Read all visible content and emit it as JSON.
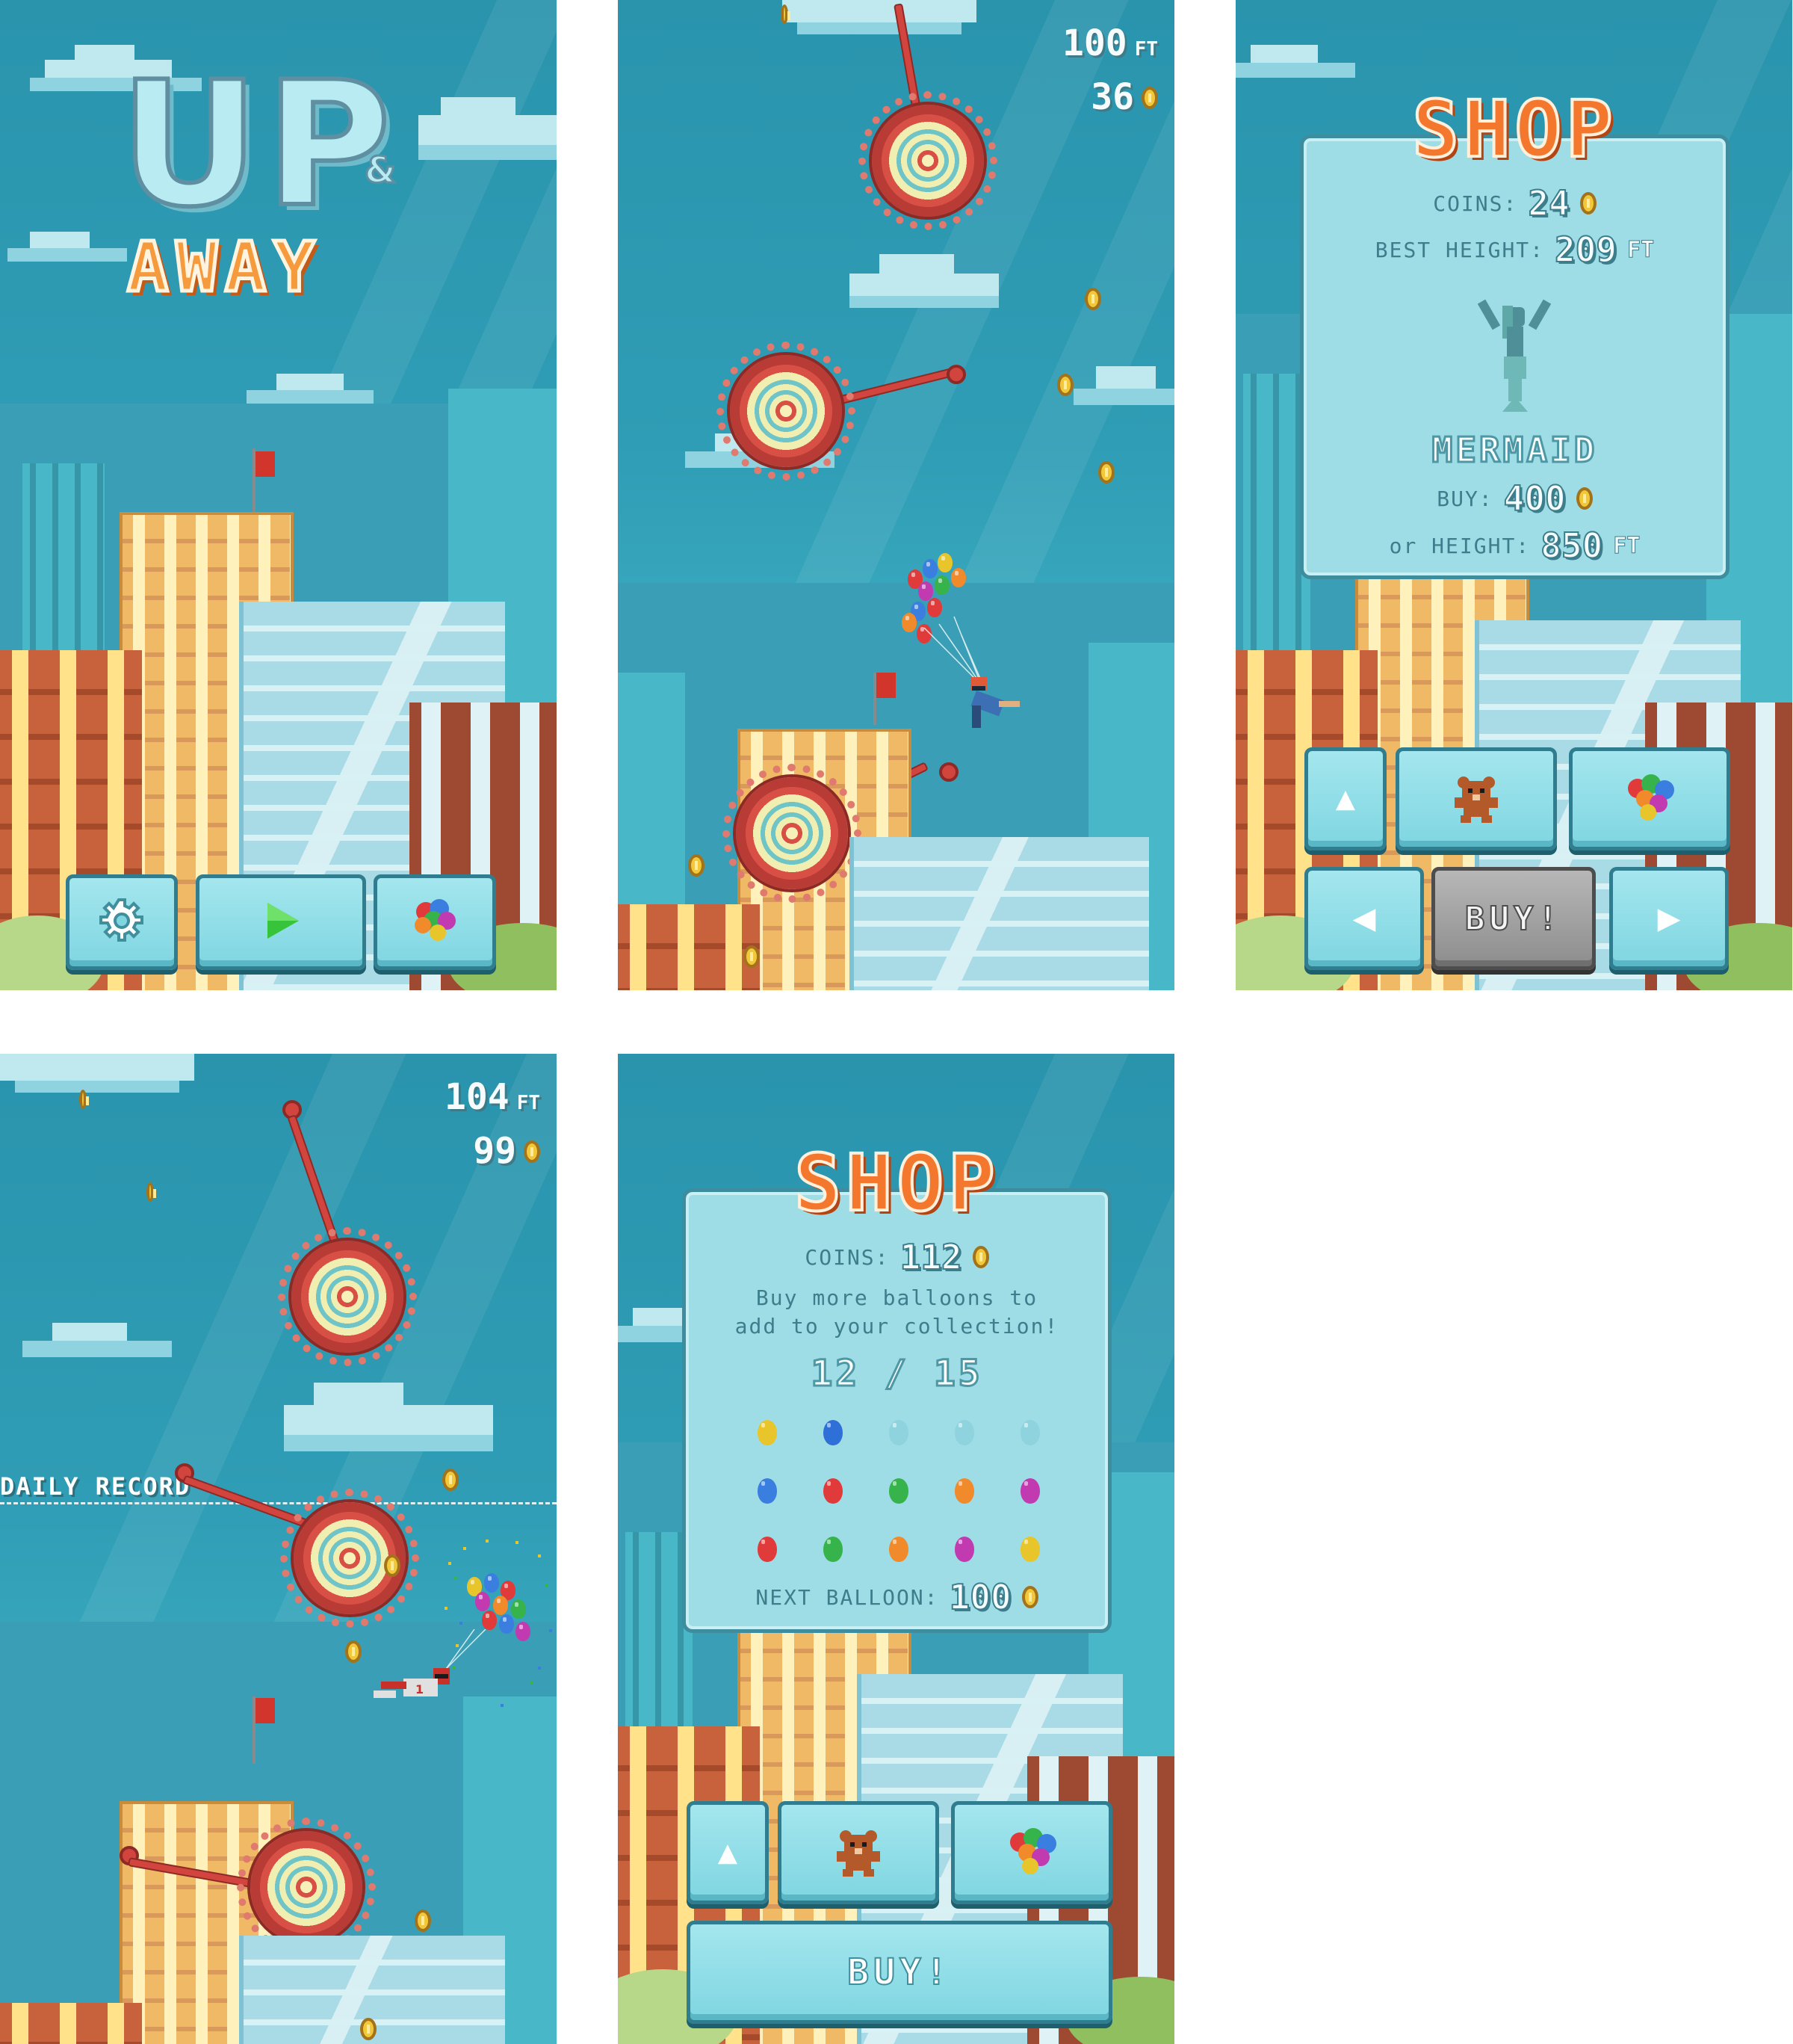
{
  "screens": {
    "title": {
      "logo_line1": "UP",
      "logo_amp": "&",
      "logo_line2": "AWAY",
      "buttons": {
        "settings_icon": "gear-icon",
        "play_icon": "play-icon",
        "balloons_icon": "balloons-icon"
      }
    },
    "gameplay1": {
      "height_value": "100",
      "height_unit": "FT",
      "coins_value": "36"
    },
    "shop_character": {
      "title": "SHOP",
      "coins_label": "COINS:",
      "coins_value": "24",
      "best_height_label": "BEST HEIGHT:",
      "best_height_value": "209",
      "best_height_unit": "FT",
      "item_name": "MERMAID",
      "buy_label": "BUY:",
      "buy_price": "400",
      "or_height_label": "or HEIGHT:",
      "or_height_value": "850",
      "or_height_unit": "FT",
      "buy_button": "BUY!",
      "colors": {
        "title": "#f4772e",
        "card": "#9fdde6"
      }
    },
    "gameplay2": {
      "height_value": "104",
      "height_unit": "FT",
      "coins_value": "99",
      "daily_record_label": "DAILY RECORD"
    },
    "shop_balloons": {
      "title": "SHOP",
      "coins_label": "COINS:",
      "coins_value": "112",
      "message_line1": "Buy more balloons to",
      "message_line2": "add to your collection!",
      "collection_count": "12 / 15",
      "next_balloon_label": "NEXT BALLOON:",
      "next_balloon_price": "100",
      "buy_button": "BUY!",
      "balloon_grid": [
        [
          "#e8c52a",
          "#2f6fd8",
          "#8fd3df",
          "#8fd3df",
          "#8fd3df"
        ],
        [
          "#3a7ee0",
          "#e03a3a",
          "#36b34a",
          "#f08a2a",
          "#c23ab0"
        ],
        [
          "#e03a3a",
          "#36b34a",
          "#f08a2a",
          "#c23ab0",
          "#e8c52a"
        ]
      ]
    }
  }
}
